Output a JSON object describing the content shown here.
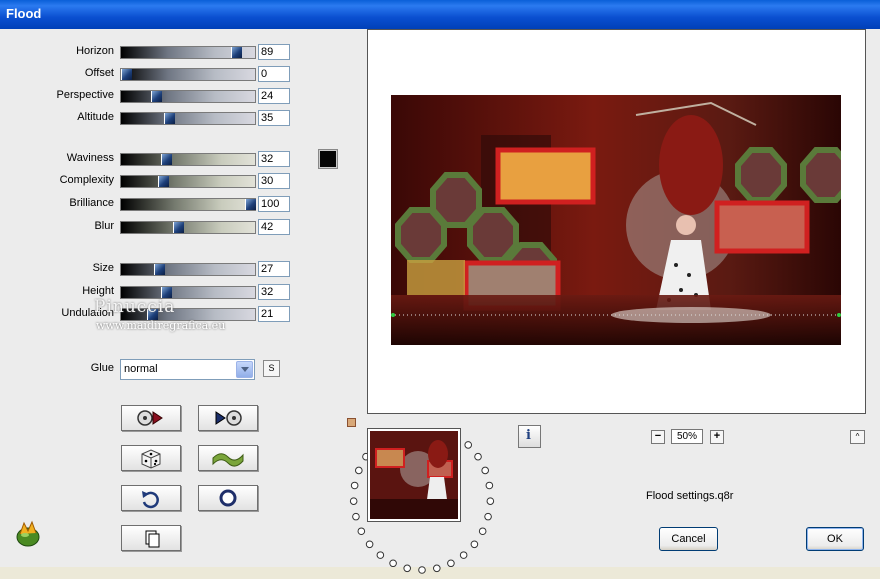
{
  "window": {
    "title": "Flood"
  },
  "sliders": [
    {
      "id": "horizon",
      "label": "Horizon",
      "value": "89",
      "fraction": 0.89,
      "style": "blue"
    },
    {
      "id": "offset",
      "label": "Offset",
      "value": "0",
      "fraction": 0.0,
      "style": "blue"
    },
    {
      "id": "perspective",
      "label": "Perspective",
      "value": "24",
      "fraction": 0.24,
      "style": "blue"
    },
    {
      "id": "altitude",
      "label": "Altitude",
      "value": "35",
      "fraction": 0.35,
      "style": "blue"
    },
    {
      "id": "waviness",
      "label": "Waviness",
      "value": "32",
      "fraction": 0.32,
      "style": "green"
    },
    {
      "id": "complexity",
      "label": "Complexity",
      "value": "30",
      "fraction": 0.3,
      "style": "green"
    },
    {
      "id": "brilliance",
      "label": "Brilliance",
      "value": "100",
      "fraction": 1.0,
      "style": "green"
    },
    {
      "id": "blur",
      "label": "Blur",
      "value": "42",
      "fraction": 0.42,
      "style": "green"
    },
    {
      "id": "size",
      "label": "Size",
      "value": "27",
      "fraction": 0.27,
      "style": "blue"
    },
    {
      "id": "height",
      "label": "Height",
      "value": "32",
      "fraction": 0.32,
      "style": "blue"
    },
    {
      "id": "undulation",
      "label": "Undulation",
      "value": "21",
      "fraction": 0.21,
      "style": "blue"
    }
  ],
  "color_swatch": {
    "color": "#050505"
  },
  "glue": {
    "label": "Glue",
    "value": "normal",
    "s_button": "S"
  },
  "icon_buttons": [
    {
      "name": "prev-settings-button",
      "icon": "reel-back-icon"
    },
    {
      "name": "next-settings-button",
      "icon": "reel-forward-icon"
    },
    {
      "name": "randomize-button",
      "icon": "dice-icon"
    },
    {
      "name": "wave-button",
      "icon": "wave-icon"
    },
    {
      "name": "undo-button",
      "icon": "undo-icon"
    },
    {
      "name": "reset-button",
      "icon": "circle-icon"
    },
    {
      "name": "copy-button",
      "icon": "copy-icon"
    }
  ],
  "watermark": {
    "line1": "Pinuccia",
    "line2": "www.maidiregrafica.eu"
  },
  "preview": {
    "info_label": "i",
    "zoom": "50%",
    "zoom_out": "−",
    "zoom_in": "+",
    "up": "^"
  },
  "settings_file": "Flood settings.q8r",
  "buttons": {
    "cancel": "Cancel",
    "ok": "OK"
  }
}
